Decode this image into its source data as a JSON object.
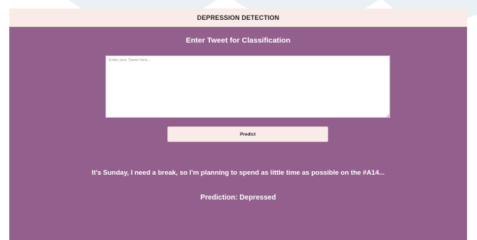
{
  "header": {
    "title": "DEPRESSION DETECTION"
  },
  "form": {
    "title": "Enter Tweet for Classification",
    "tweet_value": "",
    "tweet_placeholder": "Enter your Tweet here...",
    "predict_label": "Predict"
  },
  "result": {
    "tweet_text": "It's Sunday, I need a break, so I'm planning to spend as little time as possible on the #A14...",
    "prediction_text": "Prediction: Depressed"
  },
  "colors": {
    "header_bg": "#f9ebe8",
    "main_bg": "#93608d",
    "button_bg": "#f9ebe8",
    "text_light": "#ffffff"
  },
  "icons": {
    "resize_grip": "resize-grip-icon"
  }
}
